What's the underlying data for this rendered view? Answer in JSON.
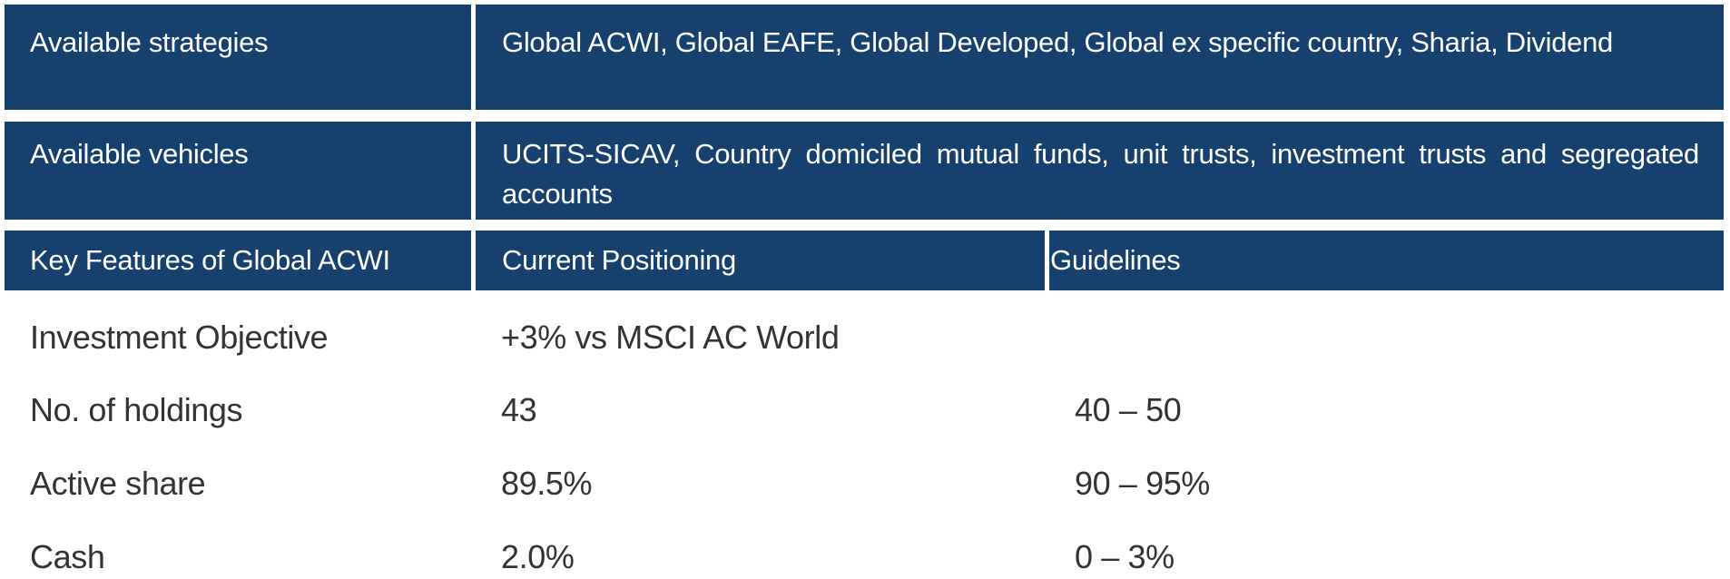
{
  "colors": {
    "header_bg": "#16416e",
    "header_text": "#ffffff",
    "body_text": "#333333"
  },
  "rows": {
    "strategies": {
      "label": "Available strategies",
      "value": "Global ACWI, Global EAFE, Global Developed, Global ex specific country, Sharia, Dividend"
    },
    "vehicles": {
      "label": "Available vehicles",
      "value": "UCITS-SICAV, Country domiciled mutual funds, unit trusts, investment trusts and segregated accounts"
    }
  },
  "table": {
    "headers": [
      "Key Features of Global ACWI",
      "Current Positioning",
      "Guidelines"
    ],
    "rows": [
      {
        "feature": "Investment Objective",
        "current": "+3% vs MSCI AC World",
        "guideline": ""
      },
      {
        "feature": "No. of holdings",
        "current": "43",
        "guideline": "40 – 50"
      },
      {
        "feature": "Active share",
        "current": "89.5%",
        "guideline": "90 – 95%"
      },
      {
        "feature": "Cash",
        "current": "2.0%",
        "guideline": "0 – 3%"
      }
    ]
  }
}
